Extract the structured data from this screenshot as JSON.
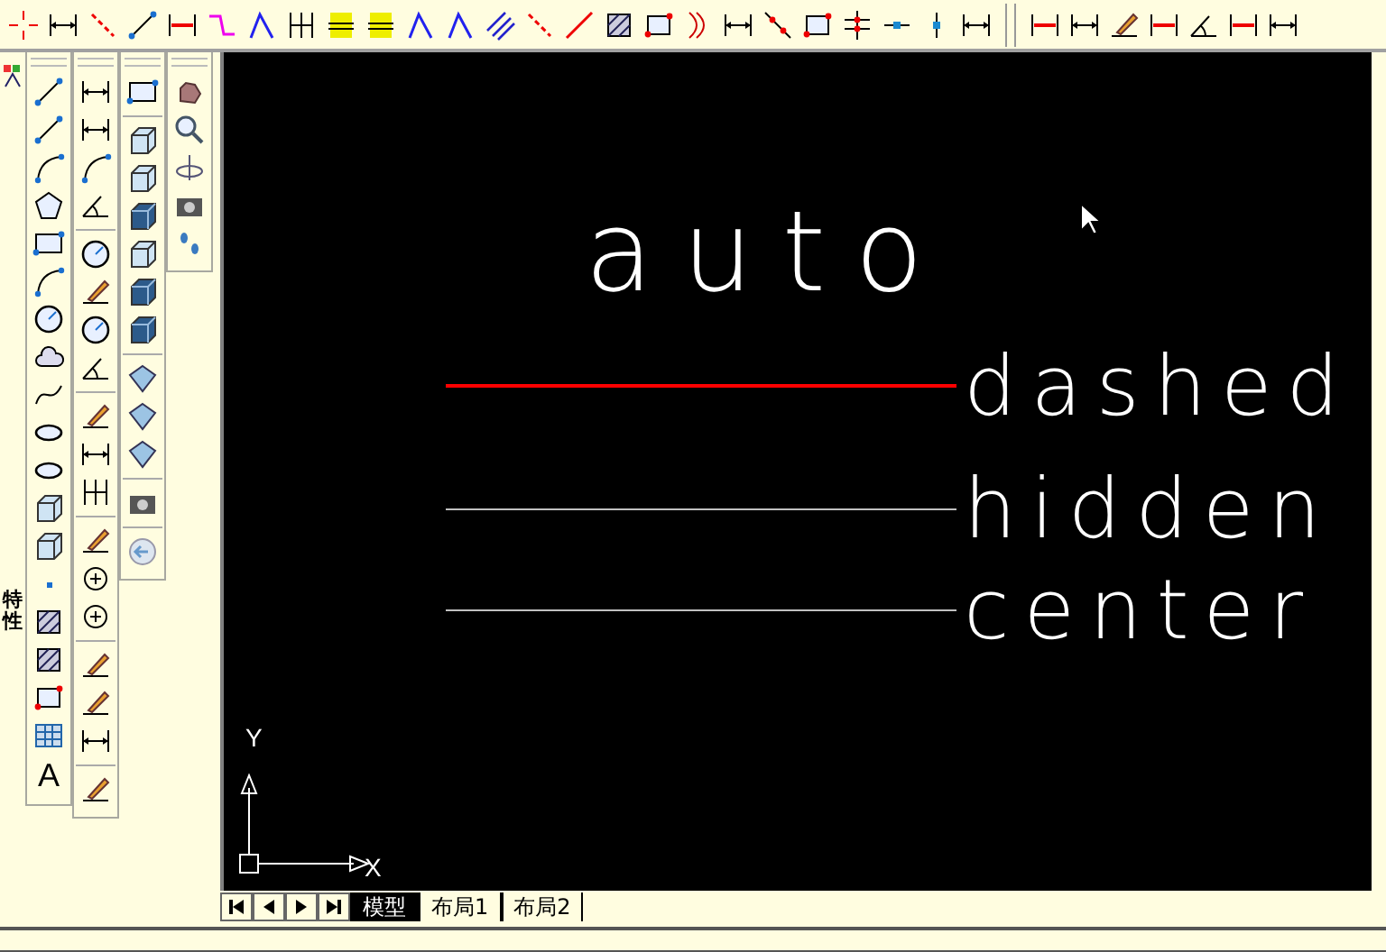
{
  "side_panel": {
    "label": "特性"
  },
  "draw_toolbar": {
    "text_glyph": "A"
  },
  "canvas": {
    "title_text": "auto",
    "lines": [
      {
        "label": "dashed",
        "color": "#ff0000"
      },
      {
        "label": "hidden",
        "color": "#c0c0c0"
      },
      {
        "label": "center",
        "color": "#c0c0c0"
      }
    ],
    "ucs": {
      "x_label": "X",
      "y_label": "Y"
    }
  },
  "layout_tabs": [
    {
      "label": "模型",
      "selected": true
    },
    {
      "label": "布局1",
      "selected": false
    },
    {
      "label": "布局2",
      "selected": false
    }
  ]
}
